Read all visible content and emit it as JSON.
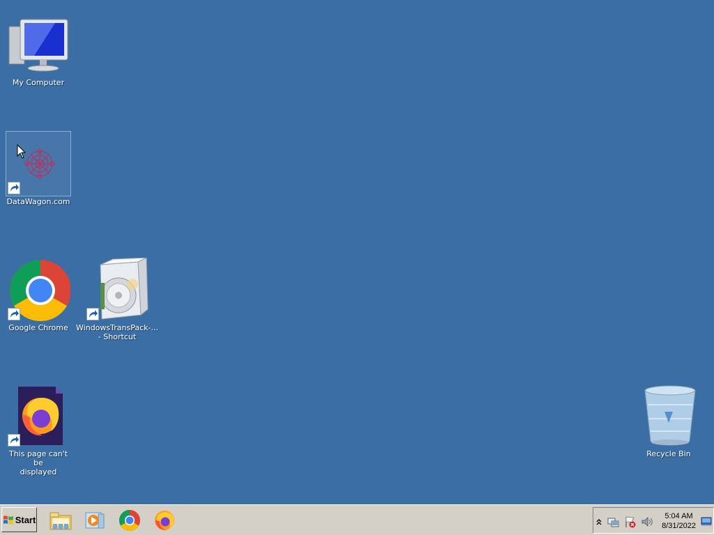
{
  "desktop": {
    "background_color": "#3b6ea5",
    "icons": [
      {
        "label": "My Computer",
        "icon": "computer-monitor-icon"
      },
      {
        "label": "DataWagon.com",
        "icon": "datawagon-red-flower-icon",
        "shortcut": true,
        "selected": true
      },
      {
        "label": "Google Chrome",
        "icon": "chrome-icon",
        "shortcut": true
      },
      {
        "label": "WindowsTransPack-...\n- Shortcut",
        "icon": "installer-box-cd-icon",
        "shortcut": true
      },
      {
        "label": "This page can't be\ndisplayed",
        "icon": "firefox-document-icon",
        "shortcut": true
      },
      {
        "label": "Recycle Bin",
        "icon": "recycle-bin-icon"
      }
    ]
  },
  "taskbar": {
    "start_label": "Start",
    "pinned": [
      {
        "name": "windows-explorer",
        "icon": "folder-icon"
      },
      {
        "name": "media-player",
        "icon": "media-player-icon"
      },
      {
        "name": "google-chrome",
        "icon": "chrome-icon"
      },
      {
        "name": "firefox",
        "icon": "firefox-icon"
      }
    ],
    "tray": {
      "icons": [
        "show-hidden-icons-chevron",
        "network-icon",
        "action-center-flag-icon",
        "volume-icon",
        "show-desktop-icon"
      ],
      "time": "5:04 AM",
      "date": "8/31/2022"
    }
  }
}
